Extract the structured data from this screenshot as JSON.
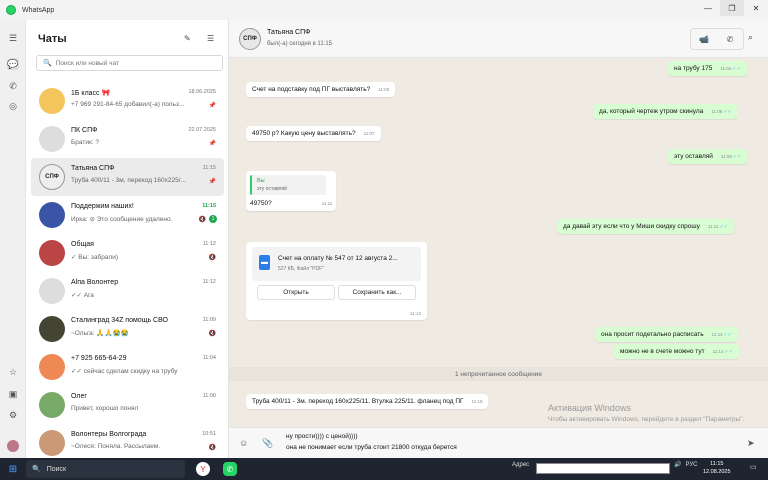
{
  "window": {
    "title": "WhatsApp"
  },
  "chatlist": {
    "heading": "Чаты",
    "search_placeholder": "Поиск или новый чат",
    "chats": [
      {
        "name": "1Б класс 🎀",
        "time": "18.06.2025",
        "preview": "+7 969 291-84-65 добавил(-а) польз...",
        "indicator": "pin-icon"
      },
      {
        "name": "ПК СПФ",
        "time": "22.07.2025",
        "preview": "Братик: ?",
        "indicator": "pin-icon"
      },
      {
        "name": "Татьяна СПФ",
        "time": "11:15",
        "preview": "Труба 400/11 - 3м, переход 160x225/...",
        "indicator": "pin-icon",
        "avatar": "СПФ"
      },
      {
        "name": "Поддержим наших!",
        "time": "11:15",
        "preview": "Ирка: ⊘ Это сообщение удалено.",
        "indicator": "mute-icon",
        "badge": "1"
      },
      {
        "name": "Общая",
        "time": "11:12",
        "preview": "✓ Вы: забрали)",
        "indicator": "mute-icon"
      },
      {
        "name": "Alпа Волонтер",
        "time": "11:12",
        "preview": "✓✓ Ага",
        "indicator": ""
      },
      {
        "name": "Сталинград 34Z помощь СВО",
        "time": "11:09",
        "preview": "~Ольга: 🙏🙏😭😭",
        "indicator": "mute-icon"
      },
      {
        "name": "+7 925 665-64-29",
        "time": "11:04",
        "preview": "✓✓ сейчас сделам скидку на трубу",
        "indicator": ""
      },
      {
        "name": "Олег",
        "time": "11:00",
        "preview": "Привет, хорошо понял",
        "indicator": ""
      },
      {
        "name": "Волонтеры Волгограда",
        "time": "10:51",
        "preview": "~Олеся: Поняла. Рассылаем.",
        "indicator": "mute-icon"
      }
    ]
  },
  "header": {
    "avatar": "СПФ",
    "name": "Татьяна СПФ",
    "status": "был(-а) сегодня в 11:15"
  },
  "messages": [
    {
      "text": "на трубу 175",
      "time": "11:04",
      "dir": "out"
    },
    {
      "text": "Счет на подставку под ПГ выставлять?",
      "time": "11:05",
      "dir": "in"
    },
    {
      "text": "да, который чертеж утром скинула",
      "time": "11:06",
      "dir": "out"
    },
    {
      "text": "49750 р? Какую цену выставлять?",
      "time": "11:07",
      "dir": "in"
    },
    {
      "text": "эту оставляй",
      "time": "11:08",
      "dir": "out"
    },
    {
      "quote_author": "Вы",
      "quote_text": "эту оставляй",
      "text": "49750?",
      "time": "11:11",
      "dir": "in"
    },
    {
      "text": "да давай эту если что у Миши скидку спрошу",
      "time": "11:11",
      "dir": "out"
    },
    {
      "text": "она просит подетально расписать",
      "time": "11:14",
      "dir": "out"
    },
    {
      "text": "можно не в счете можно тут",
      "time": "11:14",
      "dir": "out"
    },
    {
      "text": "Труба 400/11 - 3м. переход 160x225/11. Втулка 225/11. фланец под ПГ",
      "time": "11:15",
      "dir": "in"
    }
  ],
  "file": {
    "name": "Счет на оплату № 547 от 12 августа 2...",
    "meta": "527 КБ, Файл \"PDF\"",
    "open_label": "Открыть",
    "save_label": "Сохранить как...",
    "time": "11:12"
  },
  "unread_divider": "1 непрочитанное сообщение",
  "composer": {
    "line1": "ну прости)))) с ценой))))",
    "line2": "она не понимает если труба стоит 21800 откуда берется"
  },
  "watermark": {
    "title": "Активация Windows",
    "text": "Чтобы активировать Windows, перейдите в раздел \"Параметры\"."
  },
  "taskbar": {
    "search_label": "Поиск",
    "address_label": "Адрес",
    "lang": "РУС",
    "time": "11:15",
    "date": "12.08.2025"
  },
  "colors": {
    "accent": "#25d366",
    "out_bubble": "#d9fdd3",
    "chat_bg": "#efeae2",
    "ticks": "#53bdeb"
  }
}
